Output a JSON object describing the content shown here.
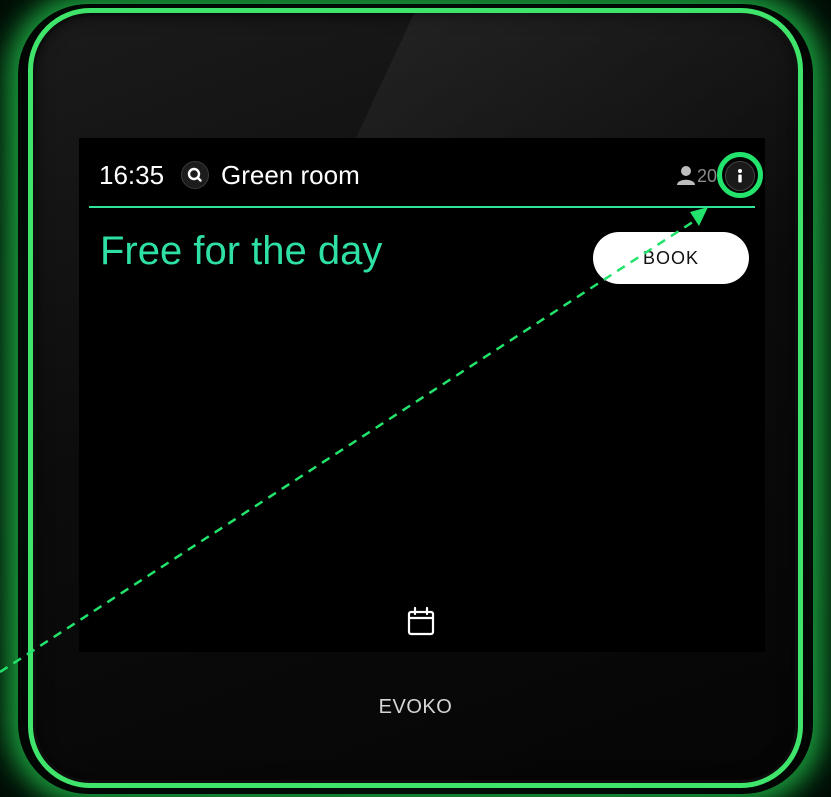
{
  "screen": {
    "time": "16:35",
    "room_name": "Green room",
    "capacity": "20",
    "status": "Free for the day",
    "book_label": "BOOK"
  },
  "device": {
    "brand": "EVOKO"
  },
  "icons": {
    "search": "search-icon",
    "person": "person-icon",
    "info": "info-icon",
    "calendar": "calendar-icon"
  },
  "colors": {
    "accent_green": "#2fe0a4",
    "highlight_green": "#22e36b",
    "device_glow": "#3fe46a",
    "screen_bg": "#000000",
    "button_bg": "#ffffff"
  }
}
